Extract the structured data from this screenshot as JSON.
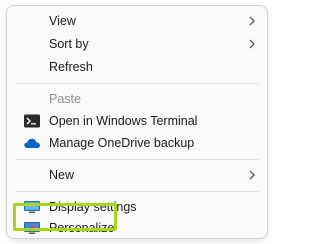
{
  "context_menu": {
    "items": [
      {
        "label": "View",
        "has_submenu": true,
        "enabled": true
      },
      {
        "label": "Sort by",
        "has_submenu": true,
        "enabled": true
      },
      {
        "label": "Refresh",
        "has_submenu": false,
        "enabled": true
      },
      {
        "label": "Paste",
        "has_submenu": false,
        "enabled": false
      },
      {
        "label": "Open in Windows Terminal",
        "icon": "terminal-icon",
        "enabled": true
      },
      {
        "label": "Manage OneDrive backup",
        "icon": "onedrive-cloud-icon",
        "enabled": true
      },
      {
        "label": "New",
        "has_submenu": true,
        "enabled": true
      },
      {
        "label": "Display settings",
        "icon": "display-icon",
        "enabled": true
      },
      {
        "label": "Personalize",
        "icon": "personalize-icon",
        "enabled": true
      }
    ],
    "highlight_color": "#a9d51a",
    "highlighted_item": "Personalize"
  }
}
